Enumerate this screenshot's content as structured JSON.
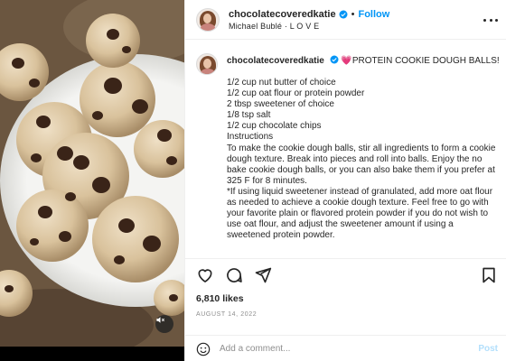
{
  "media": {
    "alt": "",
    "mute_icon": "speaker-muted-icon"
  },
  "header": {
    "username": "chocolatecoveredkatie",
    "separator": "•",
    "follow_label": "Follow",
    "audio": "Michael Bublé · L O V E"
  },
  "caption": {
    "username": "chocolatecoveredkatie",
    "heart": "💗",
    "title": "PROTEIN COOKIE DOUGH BALLS!",
    "body": "1/2 cup nut butter of choice\n1/2 cup oat flour or protein powder\n2 tbsp sweetener of choice\n1/8 tsp salt\n1/2 cup chocolate chips\nInstructions\nTo make the cookie dough balls, stir all ingredients to form a cookie dough texture. Break into pieces and roll into balls. Enjoy the no bake cookie dough balls, or you can also bake them if you prefer at 325 F for 8 minutes.\n*If using liquid sweetener instead of granulated, add more oat flour as needed to achieve a cookie dough texture. Feel free to go with your favorite plain or flavored protein powder if you do not wish to use oat flour, and adjust the sweetener amount if using a sweetened protein powder."
  },
  "actions": {
    "icons": [
      "heart-icon",
      "comment-icon",
      "share-icon",
      "bookmark-icon"
    ]
  },
  "likes": "6,810 likes",
  "date": "AUGUST 14, 2022",
  "comment": {
    "placeholder": "Add a comment...",
    "post_label": "Post"
  },
  "colors": {
    "link_blue": "#0095f6",
    "post_disabled": "#b2dffc",
    "muted_text": "#8e8e8e",
    "divider": "#efefef"
  }
}
